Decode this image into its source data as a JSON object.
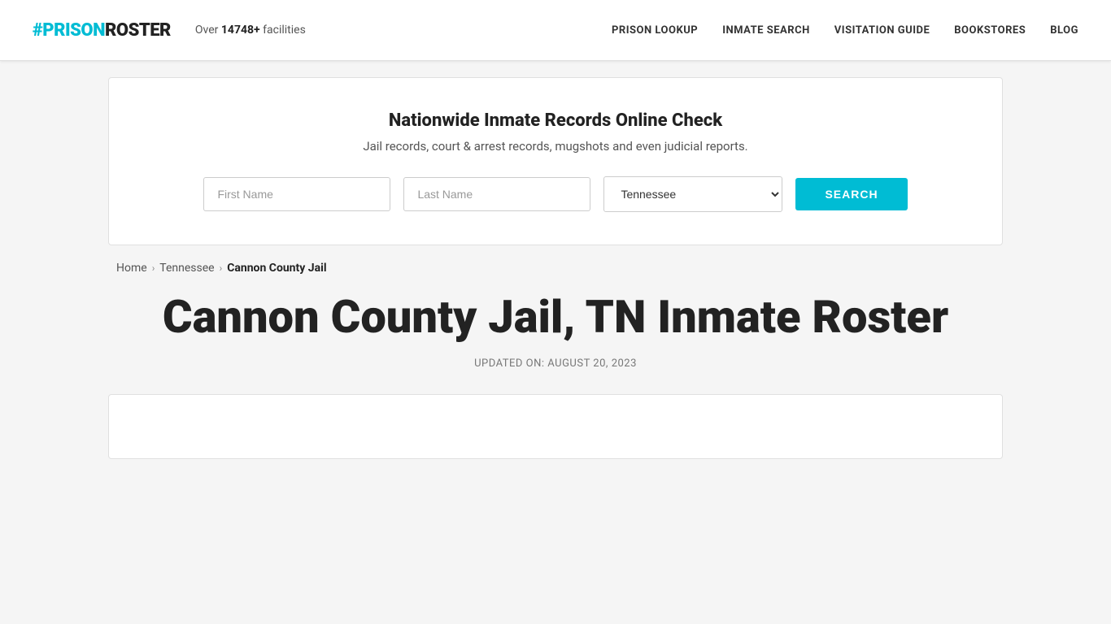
{
  "header": {
    "logo_hash": "#",
    "logo_prison": "PRISON",
    "logo_roster": "ROSTER",
    "facilities_prefix": "Over ",
    "facilities_count": "14748+",
    "facilities_suffix": " facilities",
    "nav_items": [
      {
        "id": "prison-lookup",
        "label": "PRISON LOOKUP"
      },
      {
        "id": "inmate-search",
        "label": "INMATE SEARCH"
      },
      {
        "id": "visitation-guide",
        "label": "VISITATION GUIDE"
      },
      {
        "id": "bookstores",
        "label": "BOOKSTORES"
      },
      {
        "id": "blog",
        "label": "BLOG"
      }
    ]
  },
  "search_banner": {
    "title": "Nationwide Inmate Records Online Check",
    "subtitle": "Jail records, court & arrest records, mugshots and even judicial reports.",
    "first_name_placeholder": "First Name",
    "last_name_placeholder": "Last Name",
    "state_value": "Tennessee",
    "search_button_label": "SEARCH"
  },
  "breadcrumb": {
    "home": "Home",
    "state": "Tennessee",
    "current": "Cannon County Jail"
  },
  "main": {
    "page_title": "Cannon County Jail, TN Inmate Roster",
    "updated_label": "UPDATED ON: AUGUST 20, 2023"
  }
}
